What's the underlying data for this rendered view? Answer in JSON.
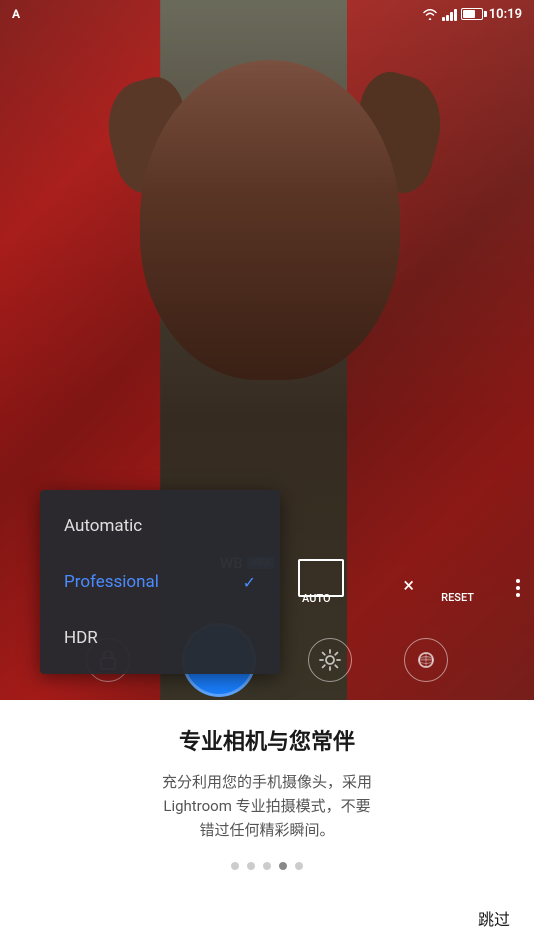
{
  "status_bar": {
    "time": "10:19"
  },
  "camera": {
    "wb_label": "WB",
    "wb_badge": "AWB",
    "auto_label": "AUTO",
    "reset_label": "RESET",
    "close_icon": "×",
    "more_icon": "⋮"
  },
  "dropdown": {
    "items": [
      {
        "label": "Automatic",
        "active": false
      },
      {
        "label": "Professional",
        "active": true
      },
      {
        "label": "HDR",
        "active": false
      }
    ]
  },
  "card": {
    "title": "专业相机与您常伴",
    "description": "充分利用您的手机摄像头，采用\nLightroom 专业拍摄模式，不要\n错过任何精彩瞬间。",
    "skip_label": "跳过"
  },
  "pagination": {
    "dots": [
      false,
      false,
      false,
      true,
      false
    ],
    "active_index": 3
  }
}
